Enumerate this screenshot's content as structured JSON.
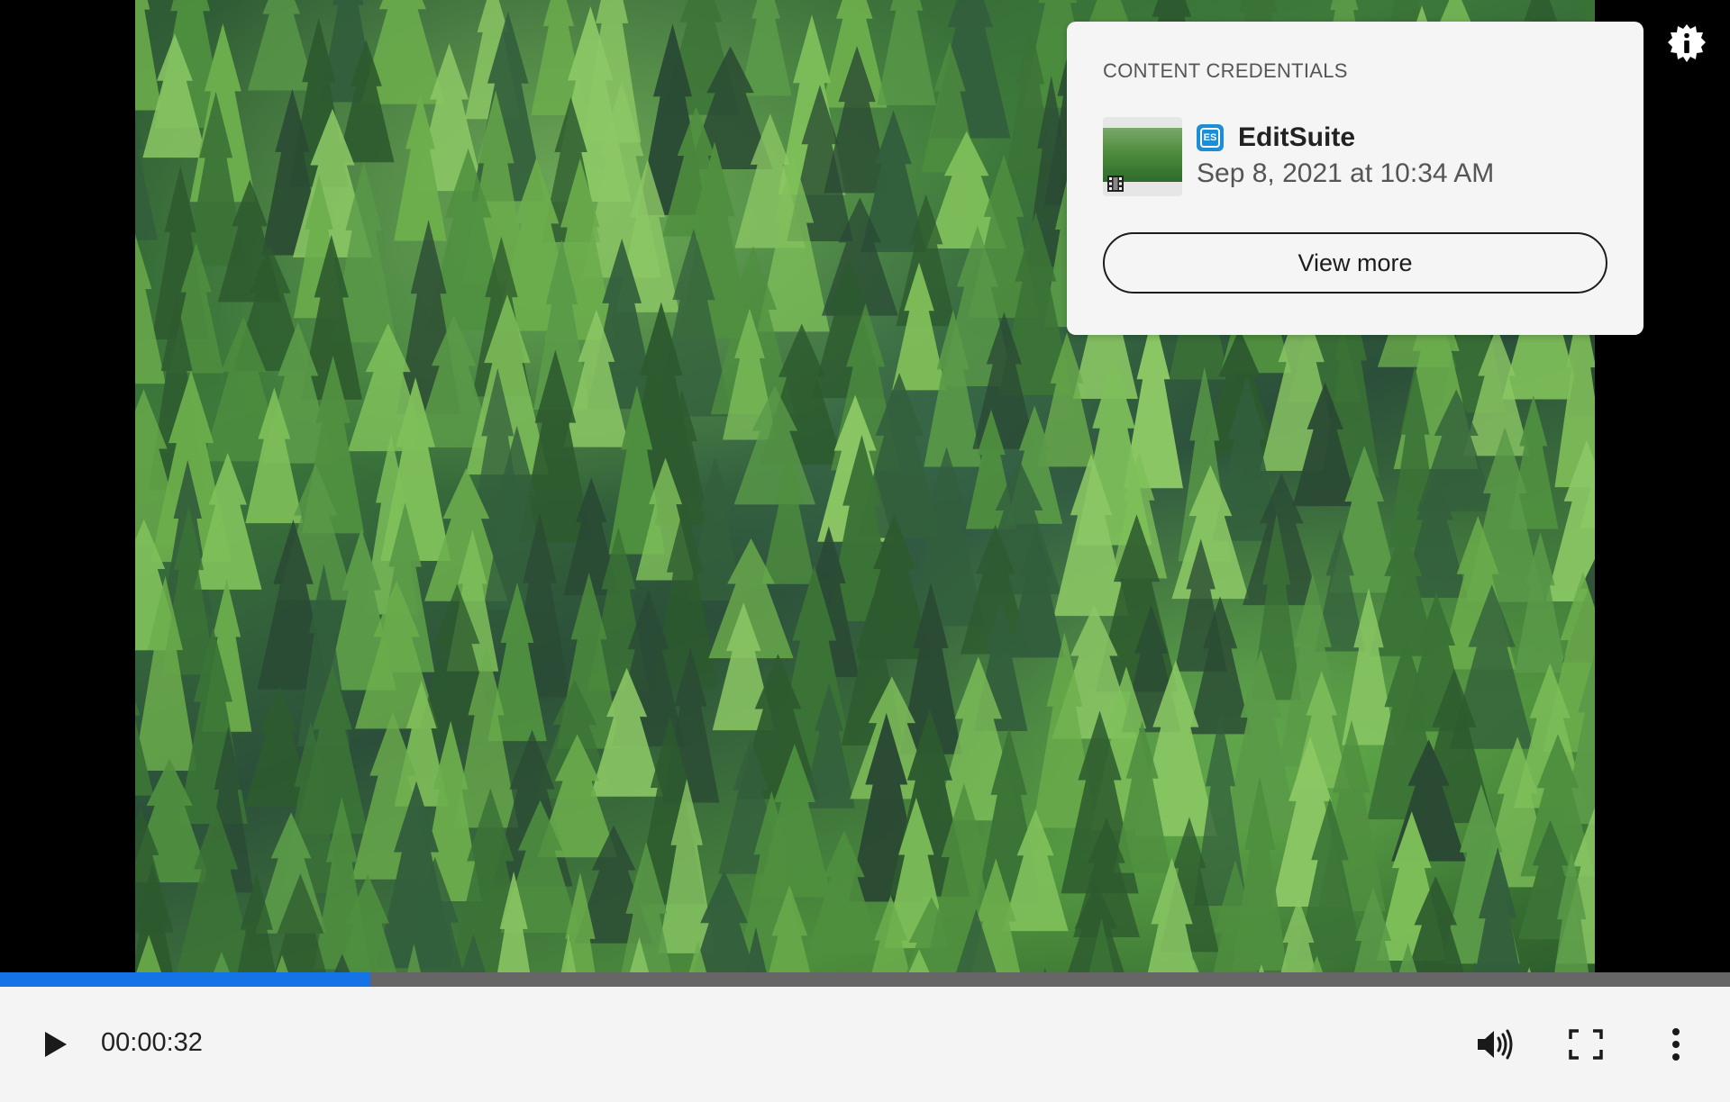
{
  "player": {
    "current_time": "00:00:32",
    "progress_fraction": 0.214,
    "accent_color": "#1473e6"
  },
  "credentials": {
    "heading": "CONTENT CREDENTIALS",
    "app_logo_text": "ES",
    "app_name": "EditSuite",
    "date": "Sep 8, 2021 at 10:34 AM",
    "view_more_label": "View more"
  },
  "icons": {
    "badge": "info-badge-icon",
    "play": "play-icon",
    "volume": "volume-icon",
    "fullscreen": "fullscreen-icon",
    "more": "more-vertical-icon",
    "film": "film-strip-icon"
  }
}
